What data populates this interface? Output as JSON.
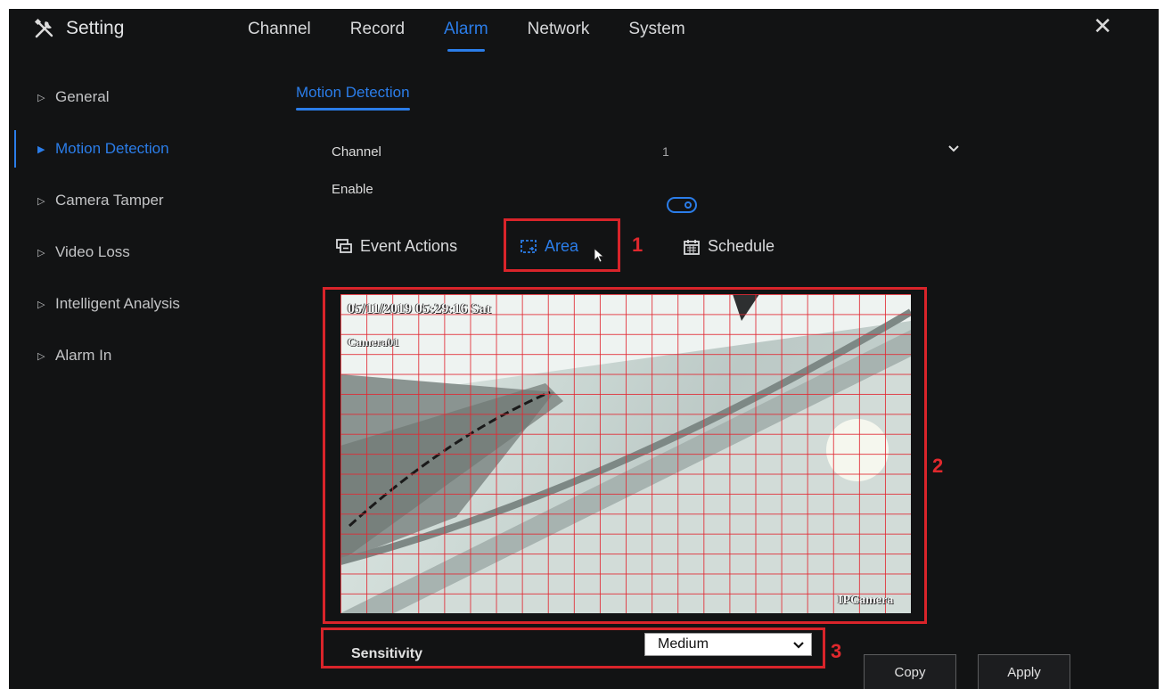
{
  "header": {
    "title": "Setting",
    "title_icon": "tools-icon",
    "tabs": [
      {
        "label": "Channel",
        "active": false
      },
      {
        "label": "Record",
        "active": false
      },
      {
        "label": "Alarm",
        "active": true
      },
      {
        "label": "Network",
        "active": false
      },
      {
        "label": "System",
        "active": false
      }
    ],
    "close_glyph": "✕"
  },
  "sidebar": {
    "items": [
      {
        "label": "General",
        "active": false
      },
      {
        "label": "Motion Detection",
        "active": true
      },
      {
        "label": "Camera Tamper",
        "active": false
      },
      {
        "label": "Video Loss",
        "active": false
      },
      {
        "label": "Intelligent Analysis",
        "active": false
      },
      {
        "label": "Alarm In",
        "active": false
      }
    ]
  },
  "main": {
    "subtab": "Motion Detection",
    "channel": {
      "label": "Channel",
      "value": "1"
    },
    "enable": {
      "label": "Enable",
      "on": true
    },
    "action_tabs": [
      {
        "label": "Event Actions",
        "icon": "event-actions-icon",
        "active": false
      },
      {
        "label": "Area",
        "icon": "area-select-icon",
        "active": true
      },
      {
        "label": "Schedule",
        "icon": "calendar-icon",
        "active": false
      }
    ],
    "camera": {
      "timestamp": "05/11/2019 05:29:16 Sat",
      "name": "Camera01",
      "watermark": "IPCamera"
    },
    "sensitivity": {
      "label": "Sensitivity",
      "value": "Medium"
    },
    "buttons": {
      "copy": "Copy",
      "apply": "Apply"
    }
  },
  "annotations": {
    "one": "1",
    "two": "2",
    "three": "3"
  },
  "colors": {
    "accent": "#2b7de9",
    "annotation": "#e0282d",
    "grid": "#e12832",
    "background": "#121314"
  }
}
